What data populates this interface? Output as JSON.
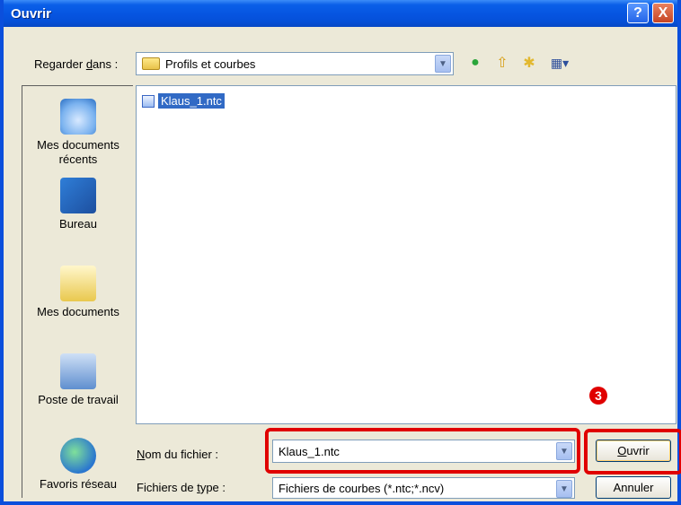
{
  "window": {
    "title": "Ouvrir",
    "help_label": "?",
    "close_label": "X"
  },
  "look_in": {
    "label": "Regarder dans :",
    "label_hotkey": "d",
    "value": "Profils et courbes"
  },
  "toolbar": {
    "back_icon": "back-arrow-icon",
    "up_icon": "up-folder-icon",
    "new_folder_icon": "new-folder-icon",
    "views_icon": "views-menu-icon"
  },
  "places": [
    {
      "label": "Mes documents récents",
      "icon": "recent-documents-icon"
    },
    {
      "label": "Bureau",
      "icon": "desktop-icon"
    },
    {
      "label": "Mes documents",
      "icon": "my-documents-icon"
    },
    {
      "label": "Poste de travail",
      "icon": "my-computer-icon"
    },
    {
      "label": "Favoris réseau",
      "icon": "network-places-icon"
    }
  ],
  "files": [
    {
      "name": "Klaus_1.ntc",
      "selected": true
    }
  ],
  "annotation": {
    "badge": "3"
  },
  "filename": {
    "label": "Nom du fichier :",
    "value": "Klaus_1.ntc"
  },
  "filetype": {
    "label": "Fichiers de type :",
    "value": "Fichiers de courbes (*.ntc;*.ncv)"
  },
  "buttons": {
    "open": "Ouvrir",
    "cancel": "Annuler"
  },
  "colors": {
    "titlebar": "#0654e0",
    "selection": "#316ac5",
    "annotation": "#e00000"
  }
}
